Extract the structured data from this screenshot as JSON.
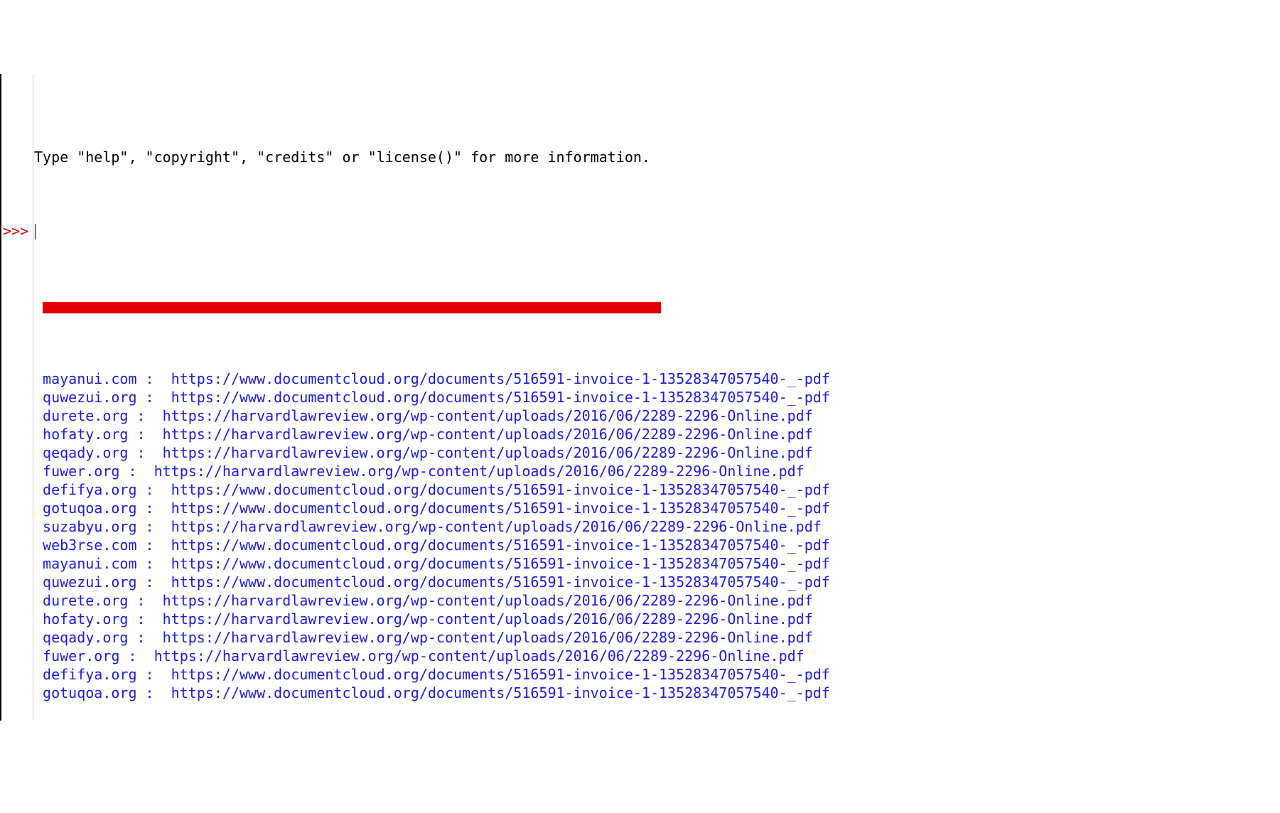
{
  "header": {
    "banner_fragment": "Type \"help\", \"copyright\", \"credits\" or \"license()\" for more information."
  },
  "prompt": ">>>",
  "output": [
    {
      "domain": "mayanui.com",
      "url": "https://www.documentcloud.org/documents/516591-invoice-1-13528347057540-_-pdf"
    },
    {
      "domain": "quwezui.org",
      "url": "https://www.documentcloud.org/documents/516591-invoice-1-13528347057540-_-pdf"
    },
    {
      "domain": "durete.org",
      "url": "https://harvardlawreview.org/wp-content/uploads/2016/06/2289-2296-Online.pdf"
    },
    {
      "domain": "hofaty.org",
      "url": "https://harvardlawreview.org/wp-content/uploads/2016/06/2289-2296-Online.pdf"
    },
    {
      "domain": "qeqady.org",
      "url": "https://harvardlawreview.org/wp-content/uploads/2016/06/2289-2296-Online.pdf"
    },
    {
      "domain": "fuwer.org",
      "url": "https://harvardlawreview.org/wp-content/uploads/2016/06/2289-2296-Online.pdf"
    },
    {
      "domain": "defifya.org",
      "url": "https://www.documentcloud.org/documents/516591-invoice-1-13528347057540-_-pdf"
    },
    {
      "domain": "gotuqoa.org",
      "url": "https://www.documentcloud.org/documents/516591-invoice-1-13528347057540-_-pdf"
    },
    {
      "domain": "suzabyu.org",
      "url": "https://harvardlawreview.org/wp-content/uploads/2016/06/2289-2296-Online.pdf"
    },
    {
      "domain": "web3rse.com",
      "url": "https://www.documentcloud.org/documents/516591-invoice-1-13528347057540-_-pdf"
    },
    {
      "domain": "mayanui.com",
      "url": "https://www.documentcloud.org/documents/516591-invoice-1-13528347057540-_-pdf"
    },
    {
      "domain": "quwezui.org",
      "url": "https://www.documentcloud.org/documents/516591-invoice-1-13528347057540-_-pdf"
    },
    {
      "domain": "durete.org",
      "url": "https://harvardlawreview.org/wp-content/uploads/2016/06/2289-2296-Online.pdf"
    },
    {
      "domain": "hofaty.org",
      "url": "https://harvardlawreview.org/wp-content/uploads/2016/06/2289-2296-Online.pdf"
    },
    {
      "domain": "qeqady.org",
      "url": "https://harvardlawreview.org/wp-content/uploads/2016/06/2289-2296-Online.pdf"
    },
    {
      "domain": "fuwer.org",
      "url": "https://harvardlawreview.org/wp-content/uploads/2016/06/2289-2296-Online.pdf"
    },
    {
      "domain": "defifya.org",
      "url": "https://www.documentcloud.org/documents/516591-invoice-1-13528347057540-_-pdf"
    },
    {
      "domain": "gotuqoa.org",
      "url": "https://www.documentcloud.org/documents/516591-invoice-1-13528347057540-_-pdf"
    }
  ]
}
